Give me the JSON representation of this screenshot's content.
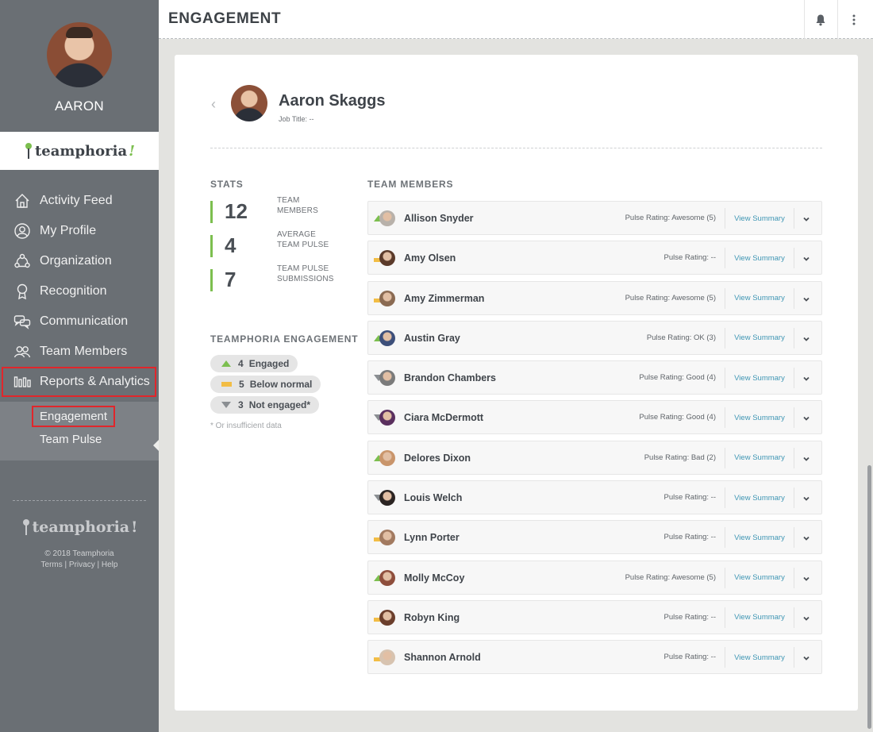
{
  "sidebar": {
    "user_name": "AARON",
    "logo_text": "teamphoria",
    "logo_bang": "!",
    "nav": [
      {
        "label": "Activity Feed",
        "icon": "home-icon"
      },
      {
        "label": "My Profile",
        "icon": "user-circle-icon"
      },
      {
        "label": "Organization",
        "icon": "organization-icon"
      },
      {
        "label": "Recognition",
        "icon": "award-ribbon-icon"
      },
      {
        "label": "Communication",
        "icon": "chat-bubbles-icon"
      },
      {
        "label": "Team Members",
        "icon": "team-icon"
      },
      {
        "label": "Reports & Analytics",
        "icon": "bar-chart-icon",
        "active": true
      }
    ],
    "subnav": [
      {
        "label": "Engagement",
        "active": true
      },
      {
        "label": "Team Pulse"
      }
    ],
    "footer": {
      "logo_text": "teamphoria",
      "logo_bang": "!",
      "copyright": "© 2018 Teamphoria",
      "links": [
        "Terms",
        "Privacy",
        "Help"
      ],
      "separator": " | "
    }
  },
  "header": {
    "title": "ENGAGEMENT",
    "icons": [
      "bell-icon",
      "more-vertical-icon"
    ]
  },
  "person": {
    "back_glyph": "‹",
    "name": "Aaron Skaggs",
    "job_title": "Job Title: --"
  },
  "stats": {
    "label": "STATS",
    "items": [
      {
        "value": "12",
        "line1": "TEAM",
        "line2": "MEMBERS"
      },
      {
        "value": "4",
        "line1": "AVERAGE",
        "line2": "TEAM PULSE"
      },
      {
        "value": "7",
        "line1": "TEAM PULSE",
        "line2": "SUBMISSIONS"
      }
    ]
  },
  "engagement": {
    "label": "TEAMPHORIA ENGAGEMENT",
    "pills": [
      {
        "count": "4",
        "label": "Engaged",
        "status": "up"
      },
      {
        "count": "5",
        "label": "Below normal",
        "status": "mid"
      },
      {
        "count": "3",
        "label": "Not engaged*",
        "status": "down"
      }
    ],
    "footnote": "* Or insufficient data"
  },
  "team": {
    "label": "TEAM MEMBERS",
    "view_label": "View Summary",
    "members": [
      {
        "name": "Allison Snyder",
        "pulse": "Pulse Rating: Awesome (5)",
        "status": "up",
        "avatar": "#b8b1aa"
      },
      {
        "name": "Amy Olsen",
        "pulse": "Pulse Rating: --",
        "status": "mid",
        "avatar": "#5b3a2a"
      },
      {
        "name": "Amy Zimmerman",
        "pulse": "Pulse Rating: Awesome (5)",
        "status": "mid",
        "avatar": "#8a6a52"
      },
      {
        "name": "Austin Gray",
        "pulse": "Pulse Rating: OK (3)",
        "status": "up",
        "avatar": "#3d4f7a"
      },
      {
        "name": "Brandon Chambers",
        "pulse": "Pulse Rating: Good (4)",
        "status": "down",
        "avatar": "#7b7b7b"
      },
      {
        "name": "Ciara McDermott",
        "pulse": "Pulse Rating: Good (4)",
        "status": "down",
        "avatar": "#5a2f5e"
      },
      {
        "name": "Delores Dixon",
        "pulse": "Pulse Rating: Bad (2)",
        "status": "up",
        "avatar": "#c9956b"
      },
      {
        "name": "Louis Welch",
        "pulse": "Pulse Rating: --",
        "status": "down",
        "avatar": "#2b2422"
      },
      {
        "name": "Lynn Porter",
        "pulse": "Pulse Rating: --",
        "status": "mid",
        "avatar": "#a27a60"
      },
      {
        "name": "Molly McCoy",
        "pulse": "Pulse Rating: Awesome (5)",
        "status": "up",
        "avatar": "#8e4e3c"
      },
      {
        "name": "Robyn King",
        "pulse": "Pulse Rating: --",
        "status": "mid",
        "avatar": "#6b3e2c"
      },
      {
        "name": "Shannon Arnold",
        "pulse": "Pulse Rating: --",
        "status": "mid",
        "avatar": "#d7c3b0"
      }
    ]
  },
  "colors": {
    "sidebar_bg": "#6a6f74",
    "engaged_green": "#7cbf4f",
    "below_normal_yellow": "#f2bd45",
    "not_engaged_gray": "#8a8e92",
    "link_blue": "#3f96b4",
    "highlight_red": "#e1262b"
  }
}
